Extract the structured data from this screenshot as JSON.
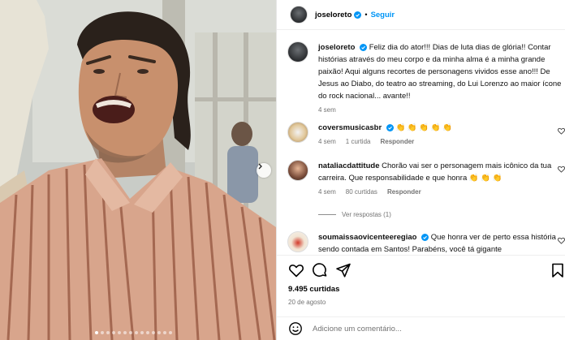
{
  "post": {
    "author": "joseloreto",
    "follow_label": "Seguir",
    "separator": "•",
    "caption": "Feliz dia do ator!!! Dias de luta dias de glória!! Contar histórias através do meu corpo e da minha alma é a minha grande paixão! Aqui alguns recortes de personagens vividos esse ano!!! De Jesus ao Diabo, do teatro ao streaming, do Lui Lorenzo ao maior ícone do rock nacional... avante!!",
    "caption_time": "4 sem",
    "likes": "9.495 curtidas",
    "date": "20 de agosto",
    "carousel_dots": 14,
    "active_dot": 0
  },
  "comments": [
    {
      "user": "coversmusicasbr",
      "text": "👏 👏 👏 👏 👏",
      "time": "4 sem",
      "likes": "1 curtida",
      "reply": "Responder"
    },
    {
      "user": "nataliacdattitude",
      "text": "Chorão vai ser o personagem mais icônico da tua carreira. Que responsabilidade e que honra 👏 👏 👏",
      "time": "4 sem",
      "likes": "80 curtidas",
      "reply": "Responder"
    },
    {
      "user": "soumaissaovicenteeregiao",
      "text": "Que honra ver de perto essa história sendo contada em Santos! Parabéns, você tá gigante"
    }
  ],
  "view_replies": "Ver respostas (1)",
  "add_comment": {
    "placeholder": "Adicione um comentário..."
  },
  "colors": {
    "accent": "#0095f6",
    "verified": "#0095f6",
    "meta": "#737373"
  }
}
